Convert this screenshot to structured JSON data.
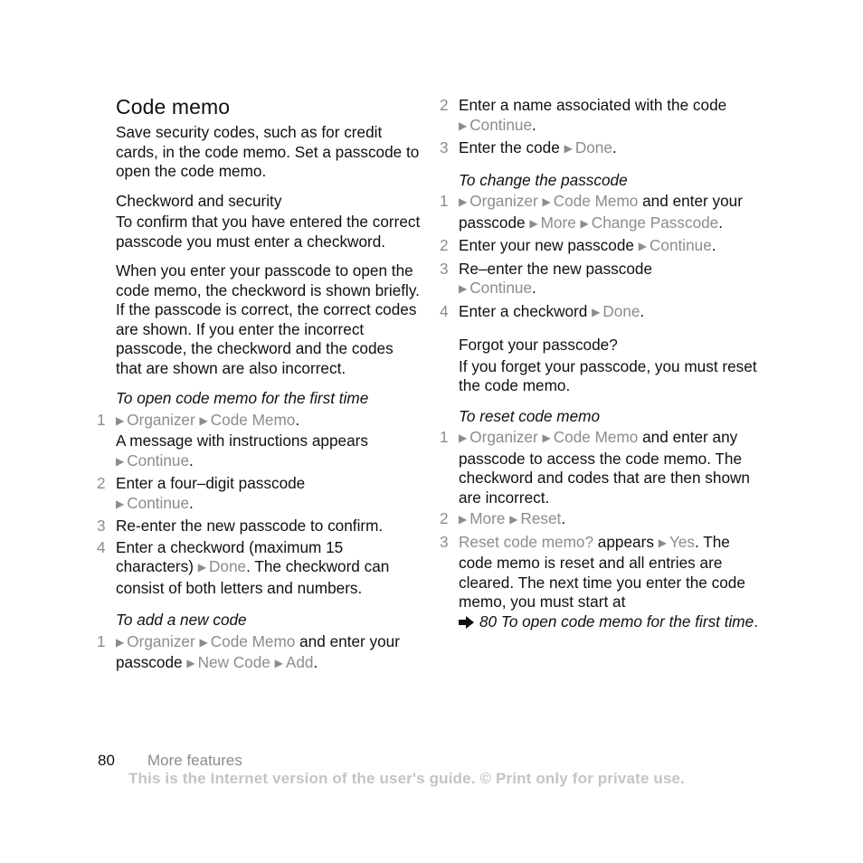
{
  "page": {
    "title": "Code memo",
    "intro": "Save security codes, such as for credit cards, in the code memo. Set a passcode to open the code memo.",
    "checkword_heading": "Checkword and security",
    "checkword_p1": "To confirm that you have entered the correct passcode you must enter a checkword.",
    "checkword_p2": "When you enter your passcode to open the code memo, the checkword is shown briefly. If the passcode is correct, the correct codes are shown. If you enter the incorrect passcode, the checkword and the codes that are shown are also incorrect.",
    "open_first_time": {
      "heading": "To open code memo for the first time",
      "steps": [
        {
          "num": "1",
          "m1": "Organizer",
          "m2": "Code Memo",
          "text_after": ".",
          "line2": "A message with instructions appears",
          "m3": "Continue",
          "end": "."
        },
        {
          "num": "2",
          "text": "Enter a four–digit passcode",
          "m1": "Continue",
          "end": "."
        },
        {
          "num": "3",
          "text": "Re-enter the new passcode to confirm."
        },
        {
          "num": "4",
          "text": "Enter a checkword (maximum 15 characters)",
          "m1": "Done",
          "text_after": ". The checkword can consist of both letters and numbers."
        }
      ]
    },
    "add_new_code": {
      "heading": "To add a new code",
      "steps": [
        {
          "num": "1",
          "m1": "Organizer",
          "m2": "Code Memo",
          "text_mid": " and enter your passcode",
          "m3": "New Code",
          "m4": "Add",
          "end": "."
        },
        {
          "num": "2",
          "text": "Enter a name associated with the code",
          "m1": "Continue",
          "end": "."
        },
        {
          "num": "3",
          "text": "Enter the code",
          "m1": "Done",
          "end": "."
        }
      ]
    },
    "change_passcode": {
      "heading": "To change the passcode",
      "steps": [
        {
          "num": "1",
          "m1": "Organizer",
          "m2": "Code Memo",
          "text_mid": " and enter your passcode",
          "m3": "More",
          "m4": "Change Passcode",
          "end": "."
        },
        {
          "num": "2",
          "text": "Enter your new passcode",
          "m1": "Continue",
          "end": "."
        },
        {
          "num": "3",
          "text": "Re–enter the new passcode",
          "m1": "Continue",
          "end": "."
        },
        {
          "num": "4",
          "text": "Enter a checkword",
          "m1": "Done",
          "end": "."
        }
      ]
    },
    "forgot_heading": "Forgot your passcode?",
    "forgot_text": "If you forget your passcode, you must reset the code memo.",
    "reset_memo": {
      "heading": "To reset code memo",
      "steps": [
        {
          "num": "1",
          "m1": "Organizer",
          "m2": "Code Memo",
          "text_after": " and enter any passcode to access the code memo. The checkword and codes that are then shown are incorrect."
        },
        {
          "num": "2",
          "m1": "More",
          "m2": "Reset",
          "end": "."
        },
        {
          "num": "3",
          "m0": "Reset code memo?",
          "text": " appears",
          "m1": "Yes",
          "text_after": ". The code memo is reset and all entries are cleared. The next time you enter the code memo, you must start at",
          "ref_page": "80",
          "ref_title": "To open code memo for the first time",
          "end": "."
        }
      ]
    }
  },
  "footer": {
    "page_number": "80",
    "section": "More features",
    "notice": "This is the Internet version of the user's guide. © Print only for private use."
  },
  "colors": {
    "text": "#111111",
    "menu_gray": "#8c8c8c",
    "notice_gray": "#c4c4c4"
  }
}
